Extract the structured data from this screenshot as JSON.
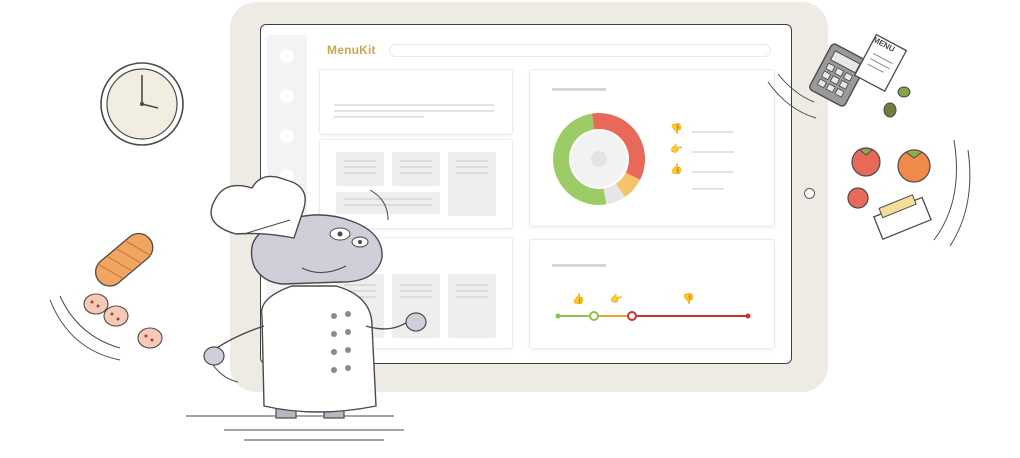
{
  "app": {
    "logo_text": "MenuKit"
  },
  "colors": {
    "brand": "#c8a84e",
    "positive": "#9ccc65",
    "neutral": "#f5c46a",
    "negative": "#e8695a",
    "muted": "#eeeeee",
    "frame": "#edebe4"
  },
  "chart_data": {
    "type": "pie",
    "title": "",
    "categories": [
      "negative",
      "neutral",
      "muted",
      "positive"
    ],
    "values": [
      35,
      8,
      7,
      50
    ],
    "colors": [
      "#e8695a",
      "#f5c46a",
      "#e6e6e6",
      "#9ccc65"
    ]
  },
  "sentiment_scale": {
    "markers": [
      "thumbs-up-icon",
      "thumbs-sideways-icon",
      "thumbs-down-icon"
    ],
    "segment_colors": [
      "#8bc34a",
      "#f0a030",
      "#d32f2f"
    ]
  },
  "sticker": {
    "label": "MENU"
  }
}
